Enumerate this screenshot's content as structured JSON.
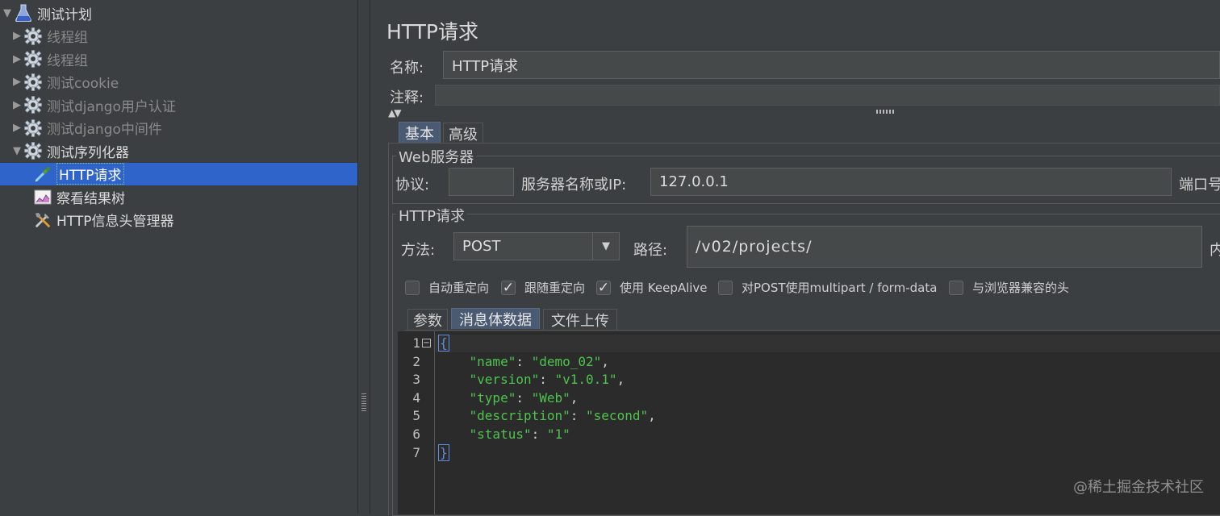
{
  "tree": {
    "items": [
      {
        "label": "测试计划",
        "icon": "flask-icon",
        "arrow": "▼",
        "indent": 0,
        "state": "enabled"
      },
      {
        "label": "线程组",
        "icon": "gear-icon",
        "arrow": "▶",
        "indent": 1,
        "state": "disabled"
      },
      {
        "label": "线程组",
        "icon": "gear-icon",
        "arrow": "▶",
        "indent": 1,
        "state": "disabled"
      },
      {
        "label": "测试cookie",
        "icon": "gear-icon",
        "arrow": "▶",
        "indent": 1,
        "state": "disabled"
      },
      {
        "label": "测试django用户认证",
        "icon": "gear-icon",
        "arrow": "▶",
        "indent": 1,
        "state": "disabled"
      },
      {
        "label": "测试django中间件",
        "icon": "gear-icon",
        "arrow": "▶",
        "indent": 1,
        "state": "disabled"
      },
      {
        "label": "测试序列化器",
        "icon": "gear-icon",
        "arrow": "▼",
        "indent": 1,
        "state": "enabled"
      },
      {
        "label": "HTTP请求",
        "icon": "pipette-icon",
        "arrow": "",
        "indent": 2,
        "state": "selected"
      },
      {
        "label": "察看结果树",
        "icon": "chart-icon",
        "arrow": "",
        "indent": 2,
        "state": "enabled"
      },
      {
        "label": "HTTP信息头管理器",
        "icon": "tools-icon",
        "arrow": "",
        "indent": 2,
        "state": "enabled"
      }
    ]
  },
  "panel": {
    "title": "HTTP请求",
    "name_label": "名称:",
    "name_value": "HTTP请求",
    "comment_label": "注释:",
    "comment_value": "",
    "tabs": [
      "基本",
      "高级"
    ],
    "web_server": {
      "title": "Web服务器",
      "protocol_label": "协议:",
      "protocol_value": "",
      "server_label": "服务器名称或IP:",
      "server_value": "127.0.0.1",
      "port_label": "端口号"
    },
    "http_request": {
      "title": "HTTP请求",
      "method_label": "方法:",
      "method_value": "POST",
      "path_label": "路径:",
      "path_value": "/v02/projects/",
      "encoding_label": "内",
      "checkboxes": [
        {
          "label": "自动重定向",
          "checked": false
        },
        {
          "label": "跟随重定向",
          "checked": true
        },
        {
          "label": "使用 KeepAlive",
          "checked": true
        },
        {
          "label": "对POST使用multipart / form-data",
          "checked": false
        },
        {
          "label": "与浏览器兼容的头",
          "checked": false
        }
      ],
      "subtabs": [
        "参数",
        "消息体数据",
        "文件上传"
      ]
    }
  },
  "editor": {
    "line_numbers": [
      "1",
      "2",
      "3",
      "4",
      "5",
      "6",
      "7"
    ],
    "lines": [
      "{",
      "    \"name\": \"demo_02\",",
      "    \"version\": \"v1.0.1\",",
      "    \"type\": \"Web\",",
      "    \"description\": \"second\",",
      "    \"status\": \"1\"",
      "}"
    ]
  },
  "watermark": "@稀土掘金技术社区",
  "colors": {
    "selection": "#2f65ca",
    "string": "#4ec44e",
    "brace": "#5c8fe0",
    "background": "#3c3f41"
  }
}
